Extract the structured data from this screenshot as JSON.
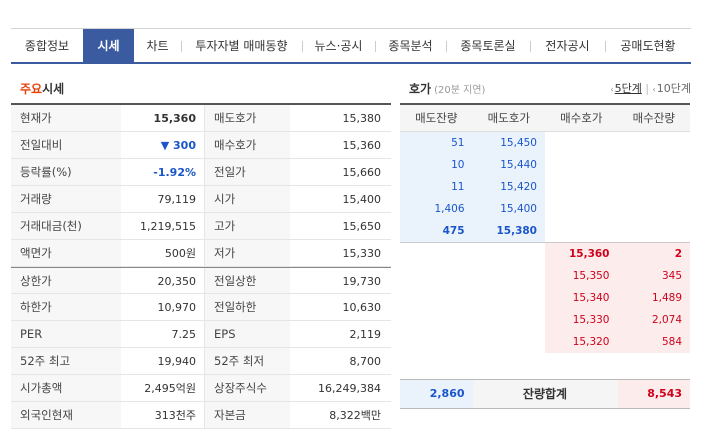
{
  "tabs": [
    "종합정보",
    "시세",
    "차트",
    "투자자별 매매동향",
    "뉴스·공시",
    "종목분석",
    "종목토론실",
    "전자공시",
    "공매도현황"
  ],
  "active_tab": "시세",
  "left": {
    "title_accent": "주요",
    "title_rest": "시세",
    "rows": [
      {
        "l1": "현재가",
        "v1": "15,360",
        "l2": "매도호가",
        "v2": "15,380"
      },
      {
        "l1": "전일대비",
        "v1": "▼ 300",
        "l2": "매수호가",
        "v2": "15,360"
      },
      {
        "l1": "등락률(%)",
        "v1": "-1.92%",
        "l2": "전일가",
        "v2": "15,660"
      },
      {
        "l1": "거래량",
        "v1": "79,119",
        "l2": "시가",
        "v2": "15,400"
      },
      {
        "l1": "거래대금(천)",
        "v1": "1,219,515",
        "l2": "고가",
        "v2": "15,650"
      },
      {
        "l1": "액면가",
        "v1": "500원",
        "l2": "저가",
        "v2": "15,330"
      },
      {
        "l1": "상한가",
        "v1": "20,350",
        "l2": "전일상한",
        "v2": "19,730"
      },
      {
        "l1": "하한가",
        "v1": "10,970",
        "l2": "전일하한",
        "v2": "10,630"
      },
      {
        "l1": "PER",
        "v1": "7.25",
        "l2": "EPS",
        "v2": "2,119"
      },
      {
        "l1": "52주 최고",
        "v1": "19,940",
        "l2": "52주 최저",
        "v2": "8,700"
      },
      {
        "l1": "시가총액",
        "v1": "2,495억원",
        "l2": "상장주식수",
        "v2": "16,249,384"
      },
      {
        "l1": "외국인현재",
        "v1": "313천주",
        "l2": "자본금",
        "v2": "8,322백만"
      }
    ]
  },
  "book": {
    "title": "호가",
    "subtitle": "(20분 지연)",
    "pager_on": "5단계",
    "pager_off": "10단계",
    "headers": [
      "매도잔량",
      "매도호가",
      "매수호가",
      "매수잔량"
    ],
    "asks": [
      {
        "qty": "51",
        "price": "15,450"
      },
      {
        "qty": "10",
        "price": "15,440"
      },
      {
        "qty": "11",
        "price": "15,420"
      },
      {
        "qty": "1,406",
        "price": "15,400"
      },
      {
        "qty": "475",
        "price": "15,380"
      }
    ],
    "bids": [
      {
        "price": "15,360",
        "qty": "2"
      },
      {
        "price": "15,350",
        "qty": "345"
      },
      {
        "price": "15,340",
        "qty": "1,489"
      },
      {
        "price": "15,330",
        "qty": "2,074"
      },
      {
        "price": "15,320",
        "qty": "584"
      }
    ],
    "sum_ask": "2,860",
    "sum_label": "잔량합계",
    "sum_bid": "8,543"
  },
  "colors": {
    "tab_active": "#3b5ba0",
    "ask_blue": "#1a56c9",
    "bid_red": "#d0021b",
    "accent": "#e8410a"
  }
}
